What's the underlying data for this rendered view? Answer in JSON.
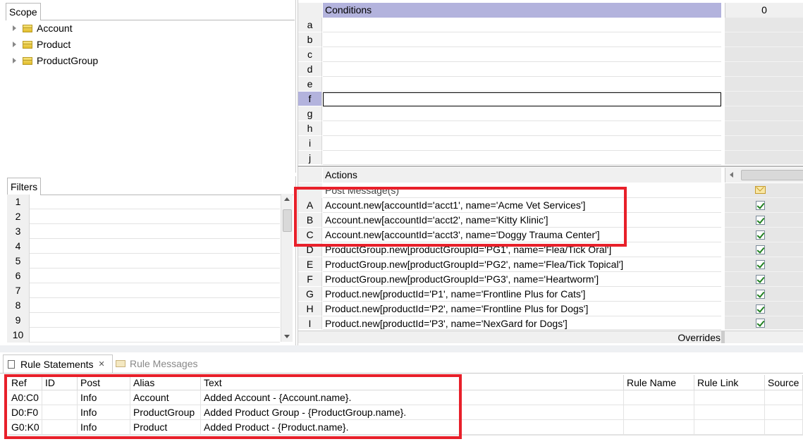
{
  "scope": {
    "tab_label": "Scope",
    "items": [
      {
        "label": "Account"
      },
      {
        "label": "Product"
      },
      {
        "label": "ProductGroup"
      }
    ]
  },
  "filters": {
    "tab_label": "Filters",
    "rows": [
      "1",
      "2",
      "3",
      "4",
      "5",
      "6",
      "7",
      "8",
      "9",
      "10"
    ]
  },
  "conditions": {
    "header": "Conditions",
    "column_header": "0",
    "rows": [
      "a",
      "b",
      "c",
      "d",
      "e",
      "f",
      "g",
      "h",
      "i",
      "j"
    ],
    "selected_row": "f"
  },
  "actions": {
    "header": "Actions",
    "post_message_label": "Post Message(s)",
    "rows": [
      {
        "ref": "A",
        "text": "Account.new[accountId='acct1', name='Acme Vet Services']",
        "checked": true
      },
      {
        "ref": "B",
        "text": "Account.new[accountId='acct2', name='Kitty Klinic']",
        "checked": true
      },
      {
        "ref": "C",
        "text": "Account.new[accountId='acct3', name='Doggy Trauma Center']",
        "checked": true
      },
      {
        "ref": "D",
        "text": "ProductGroup.new[productGroupId='PG1', name='Flea/Tick Oral']",
        "checked": true
      },
      {
        "ref": "E",
        "text": "ProductGroup.new[productGroupId='PG2', name='Flea/Tick Topical']",
        "checked": true
      },
      {
        "ref": "F",
        "text": "ProductGroup.new[productGroupId='PG3', name='Heartworm']",
        "checked": true
      },
      {
        "ref": "G",
        "text": "Product.new[productId='P1', name='Frontline Plus for Cats']",
        "checked": true
      },
      {
        "ref": "H",
        "text": "Product.new[productId='P2', name='Frontline Plus for Dogs']",
        "checked": true
      },
      {
        "ref": "I",
        "text": "Product.new[productId='P3', name='NexGard for Dogs']",
        "checked": true
      }
    ],
    "overrides_label": "Overrides"
  },
  "bottom": {
    "tab_rule_statements": "Rule Statements",
    "tab_rule_messages": "Rule Messages",
    "columns": [
      "Ref",
      "ID",
      "Post",
      "Alias",
      "Text",
      "Rule Name",
      "Rule Link",
      "Source"
    ],
    "rows": [
      {
        "ref": "A0:C0",
        "id": "",
        "post": "Info",
        "alias": "Account",
        "text": "Added Account - {Account.name}."
      },
      {
        "ref": "D0:F0",
        "id": "",
        "post": "Info",
        "alias": "ProductGroup",
        "text": "Added Product Group - {ProductGroup.name}."
      },
      {
        "ref": "G0:K0",
        "id": "",
        "post": "Info",
        "alias": "Product",
        "text": "Added Product - {Product.name}."
      }
    ]
  },
  "colors": {
    "highlight_box": "#e8202a",
    "selected_row": "#b3b3dd",
    "header_band": "#b3b3dd"
  }
}
